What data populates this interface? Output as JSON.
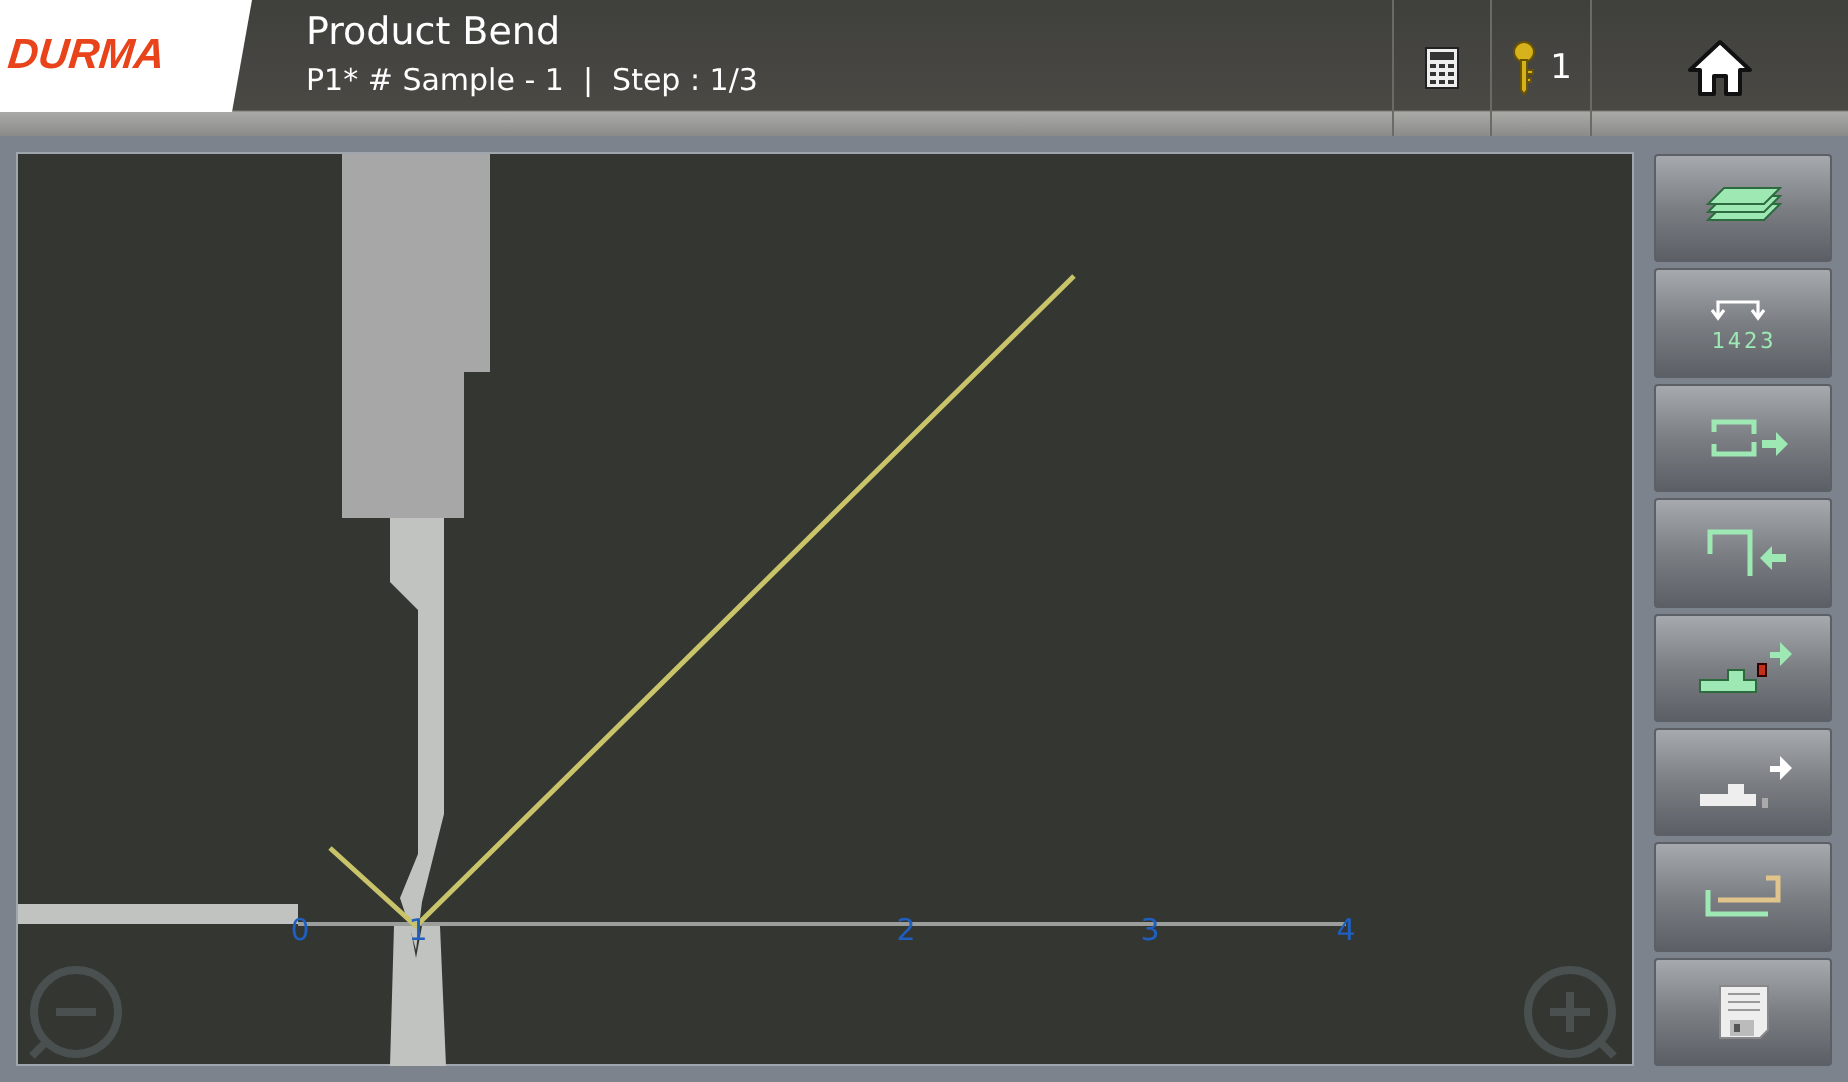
{
  "header": {
    "logo": "DURMA",
    "title": "Product Bend",
    "subtitle": "P1* # Sample - 1  |  Step : 1/3",
    "key_count": "1"
  },
  "canvas": {
    "axis_labels": [
      "0",
      "1",
      "2",
      "3",
      "4"
    ]
  },
  "tools": [
    {
      "kind": "stack"
    },
    {
      "kind": "sequence",
      "label": "1423"
    },
    {
      "kind": "flip-right"
    },
    {
      "kind": "flip-left"
    },
    {
      "kind": "gauge-forward"
    },
    {
      "kind": "gauge-next"
    },
    {
      "kind": "part"
    },
    {
      "kind": "save"
    }
  ]
}
